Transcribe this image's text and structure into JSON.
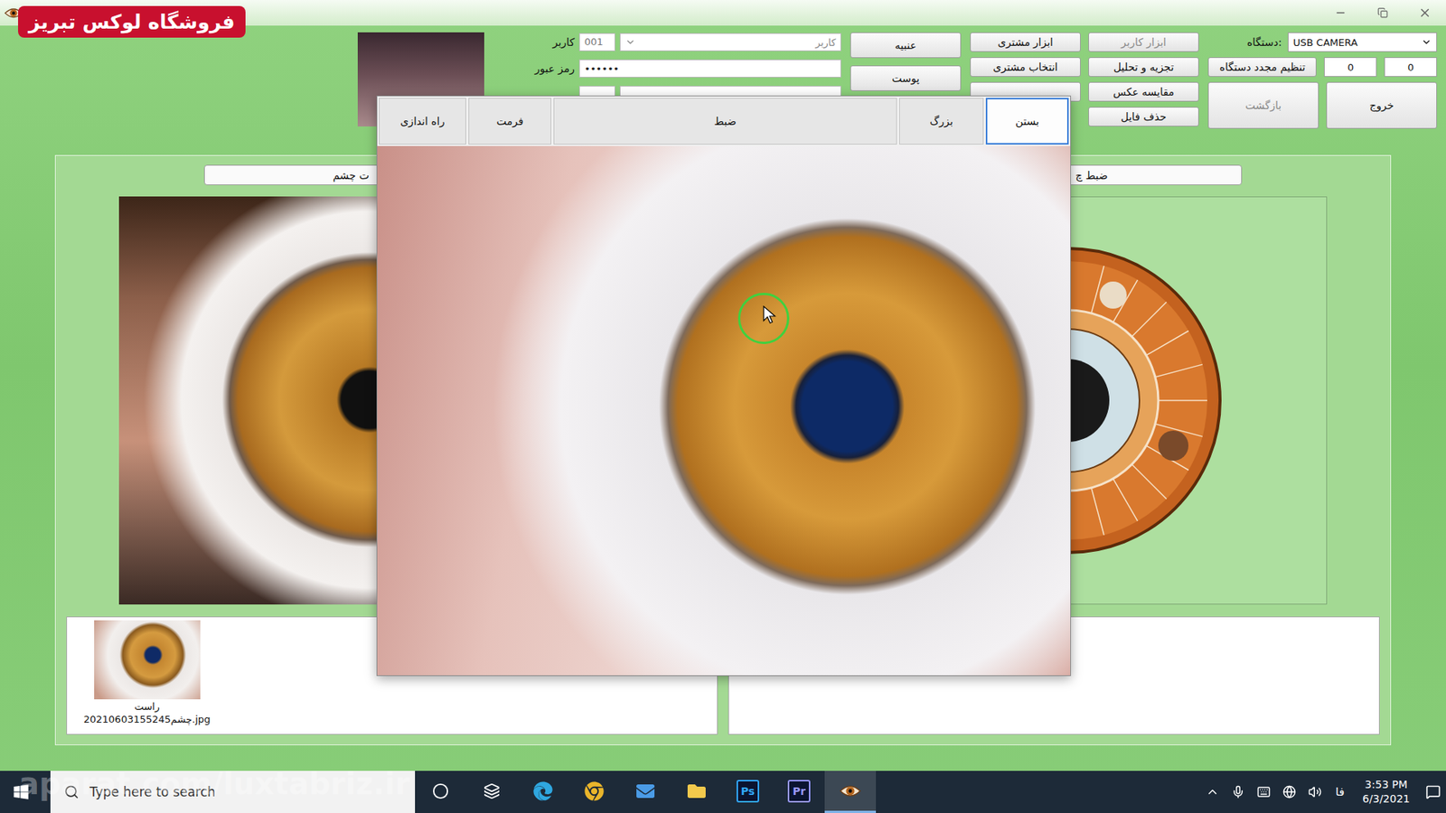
{
  "watermark": {
    "shop": "فروشگاه لوکس تبریز",
    "site": "aparat.com/luxtabriz.ir"
  },
  "account": {
    "user_label": "کاربر",
    "user_code": "001",
    "user_name": "کاربر",
    "password_label": "رمز عبور",
    "password": "••••••"
  },
  "button_columns": [
    [
      {
        "label": "عنبیه",
        "disabled": false
      },
      {
        "label": "پوست",
        "disabled": false
      }
    ],
    [
      {
        "label": "ابزار مشتری",
        "disabled": false
      },
      {
        "label": "انتخاب مشتری",
        "disabled": false
      },
      {
        "label": "",
        "disabled": false
      }
    ],
    [
      {
        "label": "ابزار کاربر",
        "disabled": true
      },
      {
        "label": "تجزیه و تحلیل",
        "disabled": false
      },
      {
        "label": "مقایسه عکس",
        "disabled": false
      },
      {
        "label": "حذف فایل",
        "disabled": false
      }
    ]
  ],
  "device": {
    "label": "دستگاه:",
    "value": "USB CAMERA",
    "reset": "تنظیم مجدد دستگاه",
    "counters": [
      "0",
      "0"
    ],
    "back": {
      "label": "بازگشت",
      "disabled": true
    },
    "exit": {
      "label": "خروج",
      "disabled": false
    }
  },
  "panel": {
    "left_bar": "ت چشم",
    "right_bar": "ضبط چ"
  },
  "gallery": {
    "items": [
      {
        "side": "راست",
        "file": "20210603155245چشم.jpg",
        "selected": false
      }
    ]
  },
  "camera_window": {
    "tools": [
      {
        "label": "راه اندازی",
        "selected": false
      },
      {
        "label": "فرمت",
        "selected": false
      },
      {
        "label": "ضبط",
        "selected": false
      },
      {
        "label": "بزرگ",
        "selected": false
      },
      {
        "label": "بستن",
        "selected": true
      }
    ]
  },
  "taskbar": {
    "search_placeholder": "Type here to search",
    "apps": [
      {
        "kind": "cortana",
        "active": false
      },
      {
        "kind": "taskview",
        "active": false
      },
      {
        "kind": "edge",
        "active": false
      },
      {
        "kind": "chrome",
        "active": false
      },
      {
        "kind": "mail",
        "active": false
      },
      {
        "kind": "explorer",
        "active": false
      },
      {
        "kind": "text",
        "text": "Ps",
        "color": "#31a8ff",
        "active": false
      },
      {
        "kind": "text",
        "text": "Pr",
        "color": "#9999ff",
        "active": false
      },
      {
        "kind": "eye",
        "active": true
      }
    ],
    "tray": {
      "language": "فا",
      "time": "3:53 PM",
      "date": "6/3/2021"
    }
  }
}
